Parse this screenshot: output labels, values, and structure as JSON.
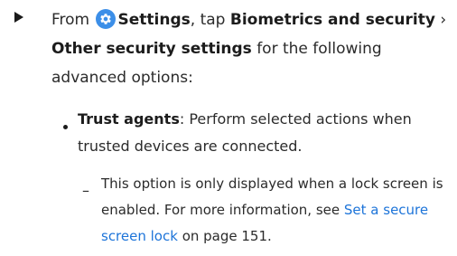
{
  "step": {
    "prefix": "From ",
    "settings_label": "Settings",
    "tap_text": ", tap ",
    "biometrics_label": "Biometrics and security",
    "chevron": " ›",
    "other_label": "Other security settings",
    "suffix": " for the following advanced options:",
    "icon": "settings-gear-icon",
    "icon_color": "#3c8fe8"
  },
  "bullet": {
    "term": "Trust agents",
    "description": ": Perform selected actions when trusted devices are connected."
  },
  "sub_bullet": {
    "dash": "–",
    "text_before": "This option is only displayed when a lock screen is enabled. For more information, see ",
    "link_text": "Set a secure screen lock",
    "text_after": " on page 151.",
    "link_color": "#1d74d9"
  }
}
